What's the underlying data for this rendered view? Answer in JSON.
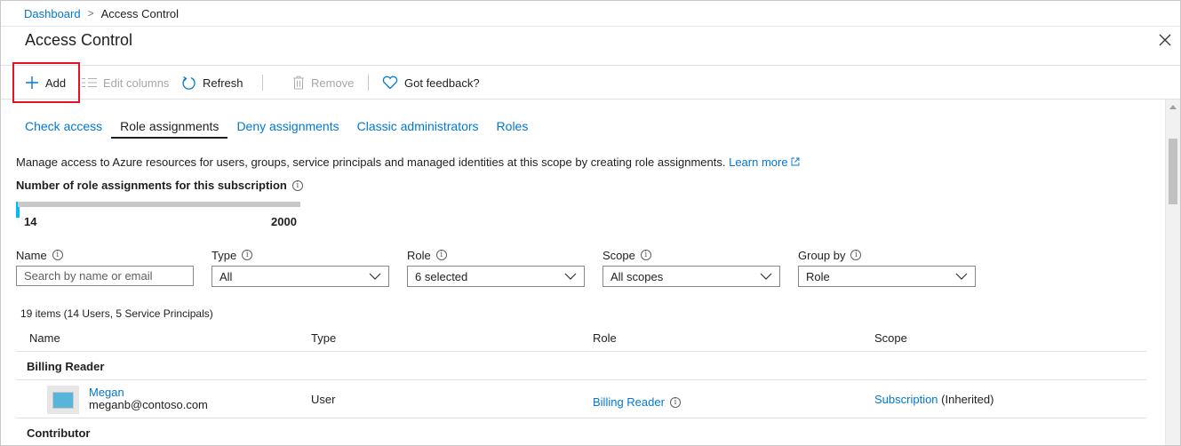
{
  "breadcrumb": {
    "root": "Dashboard",
    "current": "Access Control"
  },
  "page": {
    "title": "Access Control"
  },
  "toolbar": {
    "add": "Add",
    "edit_columns": "Edit columns",
    "refresh": "Refresh",
    "remove": "Remove",
    "feedback": "Got feedback?"
  },
  "tabs": [
    {
      "label": "Check access"
    },
    {
      "label": "Role assignments",
      "active": true
    },
    {
      "label": "Deny assignments"
    },
    {
      "label": "Classic administrators"
    },
    {
      "label": "Roles"
    }
  ],
  "description": {
    "text": "Manage access to Azure resources for users, groups, service principals and managed identities at this scope by creating role assignments.",
    "link": "Learn more"
  },
  "role_count": {
    "title": "Number of role assignments for this subscription",
    "current": 14,
    "max": 2000,
    "current_label": "14",
    "max_label": "2000"
  },
  "filters": {
    "name": {
      "label": "Name",
      "placeholder": "Search by name or email"
    },
    "type": {
      "label": "Type",
      "value": "All"
    },
    "role": {
      "label": "Role",
      "value": "6 selected"
    },
    "scope": {
      "label": "Scope",
      "value": "All scopes"
    },
    "group_by": {
      "label": "Group by",
      "value": "Role"
    }
  },
  "items_count": "19 items (14 Users, 5 Service Principals)",
  "table": {
    "headers": [
      "Name",
      "Type",
      "Role",
      "Scope"
    ],
    "groups": [
      {
        "label": "Billing Reader",
        "rows": [
          {
            "name": "Megan",
            "email": "meganb@contoso.com",
            "type": "User",
            "role": "Billing Reader",
            "scope_link": "Subscription",
            "scope_note": "(Inherited)"
          }
        ]
      },
      {
        "label": "Contributor",
        "rows": []
      }
    ]
  },
  "colors": {
    "accent": "#0078d4",
    "highlight": "#e81123",
    "progress": "#00bcf2"
  }
}
